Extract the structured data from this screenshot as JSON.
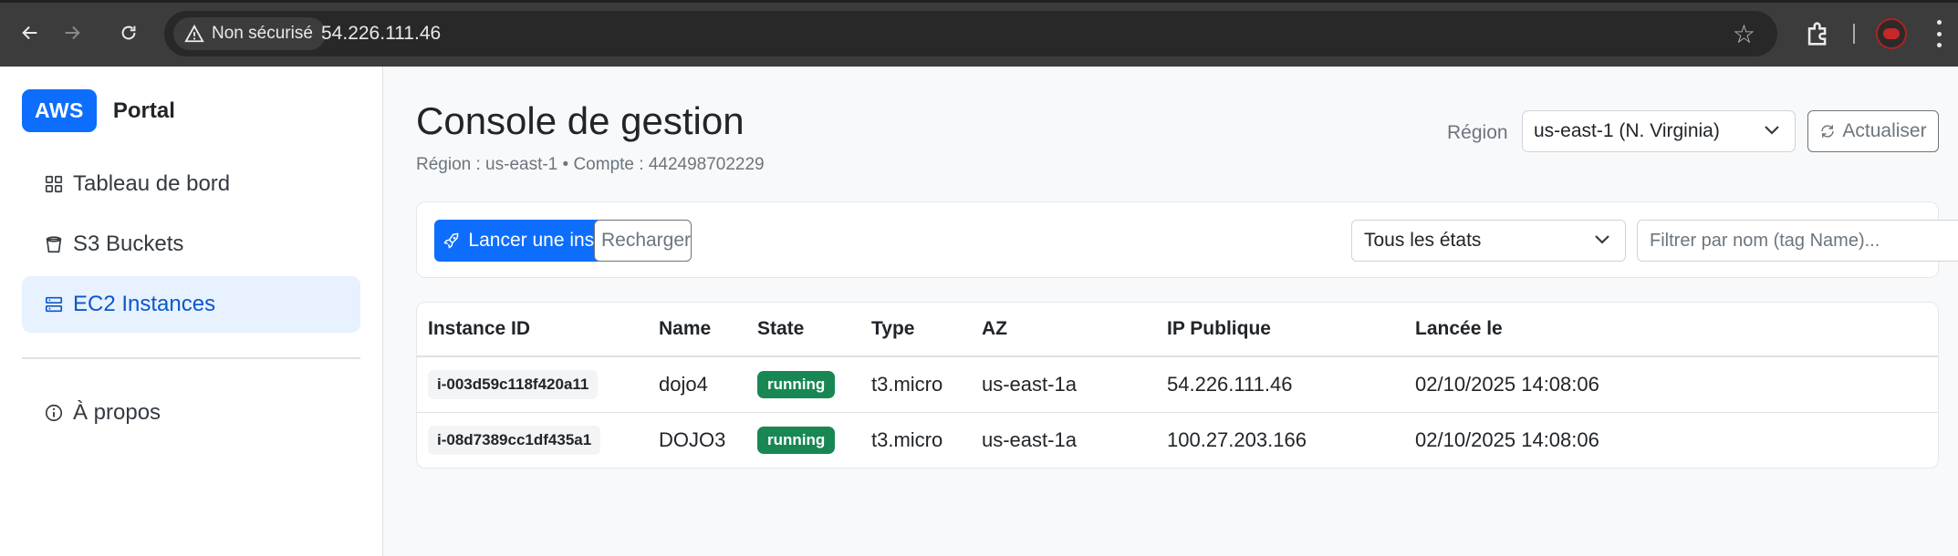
{
  "browser": {
    "security_label": "Non sécurisé",
    "url": "54.226.111.46"
  },
  "sidebar": {
    "brand_badge": "AWS",
    "brand_name": "Portal",
    "items": [
      {
        "label": "Tableau de bord",
        "icon": "grid-icon"
      },
      {
        "label": "S3 Buckets",
        "icon": "bucket-icon"
      },
      {
        "label": "EC2 Instances",
        "icon": "server-icon",
        "active": true
      },
      {
        "label": "À propos",
        "icon": "info-icon"
      }
    ]
  },
  "header": {
    "title": "Console de gestion",
    "subtitle": "Région : us-east-1 • Compte : 442498702229",
    "region_label": "Région",
    "region_value": "us-east-1 (N. Virginia)",
    "refresh_label": "Actualiser"
  },
  "toolbar": {
    "launch_label": "Lancer une instance",
    "reload_label": "Recharger",
    "state_filter_value": "Tous les états",
    "name_filter_placeholder": "Filtrer par nom (tag Name)..."
  },
  "table": {
    "columns": [
      "Instance ID",
      "Name",
      "State",
      "Type",
      "AZ",
      "IP Publique",
      "Lancée le"
    ],
    "rows": [
      {
        "id": "i-003d59c118f420a11",
        "name": "dojo4",
        "state": "running",
        "type": "t3.micro",
        "az": "us-east-1a",
        "ip": "54.226.111.46",
        "launched": "02/10/2025 14:08:06"
      },
      {
        "id": "i-08d7389cc1df435a1",
        "name": "DOJO3",
        "state": "running",
        "type": "t3.micro",
        "az": "us-east-1a",
        "ip": "100.27.203.166",
        "launched": "02/10/2025 14:08:06"
      }
    ]
  },
  "colors": {
    "primary": "#0d6efd",
    "running": "#198754",
    "active_nav_bg": "#e7f1ff"
  }
}
